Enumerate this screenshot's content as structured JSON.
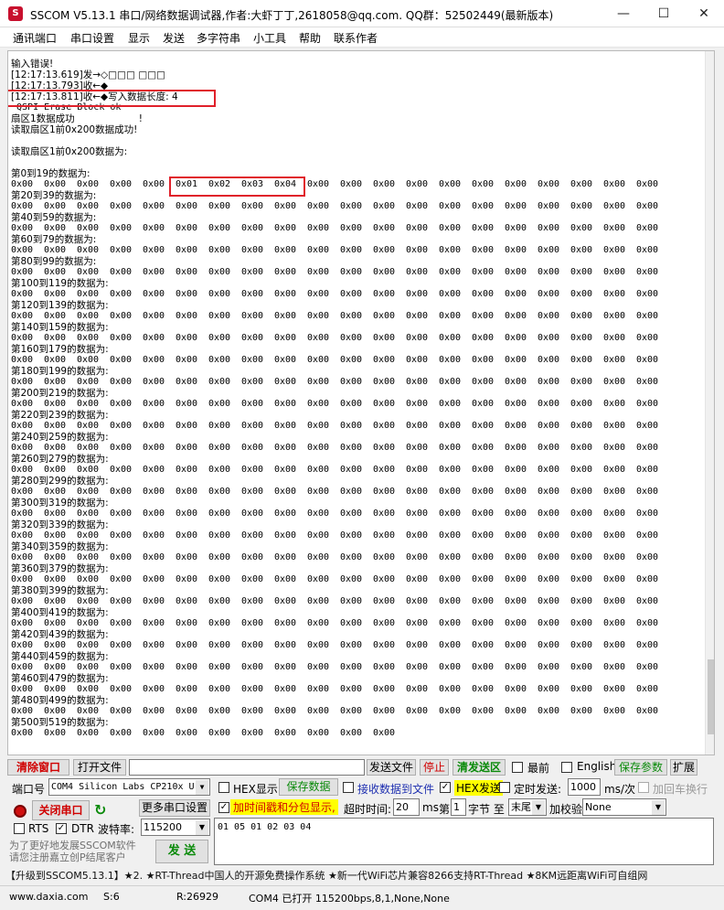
{
  "window": {
    "title": "SSCOM V5.13.1 串口/网络数据调试器,作者:大虾丁丁,2618058@qq.com. QQ群：52502449(最新版本)",
    "app_icon_glyph": "S",
    "minimize_glyph": "—",
    "maximize_glyph": "☐",
    "close_glyph": "✕"
  },
  "menu": {
    "items": [
      "通讯端口",
      "串口设置",
      "显示",
      "发送",
      "多字符串",
      "小工具",
      "帮助",
      "联系作者"
    ]
  },
  "terminal": {
    "lines": [
      "输入错误!",
      "[12:17:13.619]发→◇□□□ □□□",
      "[12:17:13.793]收←◆",
      "[12:17:13.811]收←◆写入数据长度: 4",
      " QSPI Erase Block ok",
      "扇区1数据成功                     !",
      "读取扇区1前0x200数据成功!",
      "",
      "读取扇区1前0x200数据为:",
      ""
    ],
    "block_headers": [
      "第0到19的数据为:",
      "第20到39的数据为:",
      "第40到59的数据为:",
      "第60到79的数据为:",
      "第80到99的数据为:",
      "第100到119的数据为:",
      "第120到139的数据为:",
      "第140到159的数据为:",
      "第160到179的数据为:",
      "第180到199的数据为:",
      "第200到219的数据为:",
      "第220到239的数据为:",
      "第240到259的数据为:",
      "第260到279的数据为:",
      "第280到299的数据为:",
      "第300到319的数据为:",
      "第320到339的数据为:",
      "第340到359的数据为:",
      "第360到379的数据为:",
      "第380到399的数据为:",
      "第400到419的数据为:",
      "第420到439的数据为:",
      "第440到459的数据为:",
      "第460到479的数据为:",
      "第480到499的数据为:",
      "第500到519的数据为:"
    ],
    "hex_rows": [
      [
        "0x00",
        "0x00",
        "0x00",
        "0x00",
        "0x00",
        "0x01",
        "0x02",
        "0x03",
        "0x04",
        "0x00",
        "0x00",
        "0x00",
        "0x00",
        "0x00",
        "0x00",
        "0x00",
        "0x00",
        "0x00",
        "0x00",
        "0x00"
      ],
      [
        "0x00",
        "0x00",
        "0x00",
        "0x00",
        "0x00",
        "0x00",
        "0x00",
        "0x00",
        "0x00",
        "0x00",
        "0x00",
        "0x00",
        "0x00",
        "0x00",
        "0x00",
        "0x00",
        "0x00",
        "0x00",
        "0x00",
        "0x00"
      ],
      [
        "0x00",
        "0x00",
        "0x00",
        "0x00",
        "0x00",
        "0x00",
        "0x00",
        "0x00",
        "0x00",
        "0x00",
        "0x00",
        "0x00",
        "0x00",
        "0x00",
        "0x00",
        "0x00",
        "0x00",
        "0x00",
        "0x00",
        "0x00"
      ],
      [
        "0x00",
        "0x00",
        "0x00",
        "0x00",
        "0x00",
        "0x00",
        "0x00",
        "0x00",
        "0x00",
        "0x00",
        "0x00",
        "0x00",
        "0x00",
        "0x00",
        "0x00",
        "0x00",
        "0x00",
        "0x00",
        "0x00",
        "0x00"
      ],
      [
        "0x00",
        "0x00",
        "0x00",
        "0x00",
        "0x00",
        "0x00",
        "0x00",
        "0x00",
        "0x00",
        "0x00",
        "0x00",
        "0x00",
        "0x00",
        "0x00",
        "0x00",
        "0x00",
        "0x00",
        "0x00",
        "0x00",
        "0x00"
      ],
      [
        "0x00",
        "0x00",
        "0x00",
        "0x00",
        "0x00",
        "0x00",
        "0x00",
        "0x00",
        "0x00",
        "0x00",
        "0x00",
        "0x00",
        "0x00",
        "0x00",
        "0x00",
        "0x00",
        "0x00",
        "0x00",
        "0x00",
        "0x00"
      ],
      [
        "0x00",
        "0x00",
        "0x00",
        "0x00",
        "0x00",
        "0x00",
        "0x00",
        "0x00",
        "0x00",
        "0x00",
        "0x00",
        "0x00",
        "0x00",
        "0x00",
        "0x00",
        "0x00",
        "0x00",
        "0x00",
        "0x00",
        "0x00"
      ],
      [
        "0x00",
        "0x00",
        "0x00",
        "0x00",
        "0x00",
        "0x00",
        "0x00",
        "0x00",
        "0x00",
        "0x00",
        "0x00",
        "0x00",
        "0x00",
        "0x00",
        "0x00",
        "0x00",
        "0x00",
        "0x00",
        "0x00",
        "0x00"
      ],
      [
        "0x00",
        "0x00",
        "0x00",
        "0x00",
        "0x00",
        "0x00",
        "0x00",
        "0x00",
        "0x00",
        "0x00",
        "0x00",
        "0x00",
        "0x00",
        "0x00",
        "0x00",
        "0x00",
        "0x00",
        "0x00",
        "0x00",
        "0x00"
      ],
      [
        "0x00",
        "0x00",
        "0x00",
        "0x00",
        "0x00",
        "0x00",
        "0x00",
        "0x00",
        "0x00",
        "0x00",
        "0x00",
        "0x00",
        "0x00",
        "0x00",
        "0x00",
        "0x00",
        "0x00",
        "0x00",
        "0x00",
        "0x00"
      ],
      [
        "0x00",
        "0x00",
        "0x00",
        "0x00",
        "0x00",
        "0x00",
        "0x00",
        "0x00",
        "0x00",
        "0x00",
        "0x00",
        "0x00",
        "0x00",
        "0x00",
        "0x00",
        "0x00",
        "0x00",
        "0x00",
        "0x00",
        "0x00"
      ],
      [
        "0x00",
        "0x00",
        "0x00",
        "0x00",
        "0x00",
        "0x00",
        "0x00",
        "0x00",
        "0x00",
        "0x00",
        "0x00",
        "0x00",
        "0x00",
        "0x00",
        "0x00",
        "0x00",
        "0x00",
        "0x00",
        "0x00",
        "0x00"
      ],
      [
        "0x00",
        "0x00",
        "0x00",
        "0x00",
        "0x00",
        "0x00",
        "0x00",
        "0x00",
        "0x00",
        "0x00",
        "0x00",
        "0x00",
        "0x00",
        "0x00",
        "0x00",
        "0x00",
        "0x00",
        "0x00",
        "0x00",
        "0x00"
      ],
      [
        "0x00",
        "0x00",
        "0x00",
        "0x00",
        "0x00",
        "0x00",
        "0x00",
        "0x00",
        "0x00",
        "0x00",
        "0x00",
        "0x00",
        "0x00",
        "0x00",
        "0x00",
        "0x00",
        "0x00",
        "0x00",
        "0x00",
        "0x00"
      ],
      [
        "0x00",
        "0x00",
        "0x00",
        "0x00",
        "0x00",
        "0x00",
        "0x00",
        "0x00",
        "0x00",
        "0x00",
        "0x00",
        "0x00",
        "0x00",
        "0x00",
        "0x00",
        "0x00",
        "0x00",
        "0x00",
        "0x00",
        "0x00"
      ],
      [
        "0x00",
        "0x00",
        "0x00",
        "0x00",
        "0x00",
        "0x00",
        "0x00",
        "0x00",
        "0x00",
        "0x00",
        "0x00",
        "0x00",
        "0x00",
        "0x00",
        "0x00",
        "0x00",
        "0x00",
        "0x00",
        "0x00",
        "0x00"
      ],
      [
        "0x00",
        "0x00",
        "0x00",
        "0x00",
        "0x00",
        "0x00",
        "0x00",
        "0x00",
        "0x00",
        "0x00",
        "0x00",
        "0x00",
        "0x00",
        "0x00",
        "0x00",
        "0x00",
        "0x00",
        "0x00",
        "0x00",
        "0x00"
      ],
      [
        "0x00",
        "0x00",
        "0x00",
        "0x00",
        "0x00",
        "0x00",
        "0x00",
        "0x00",
        "0x00",
        "0x00",
        "0x00",
        "0x00",
        "0x00",
        "0x00",
        "0x00",
        "0x00",
        "0x00",
        "0x00",
        "0x00",
        "0x00"
      ],
      [
        "0x00",
        "0x00",
        "0x00",
        "0x00",
        "0x00",
        "0x00",
        "0x00",
        "0x00",
        "0x00",
        "0x00",
        "0x00",
        "0x00",
        "0x00",
        "0x00",
        "0x00",
        "0x00",
        "0x00",
        "0x00",
        "0x00",
        "0x00"
      ],
      [
        "0x00",
        "0x00",
        "0x00",
        "0x00",
        "0x00",
        "0x00",
        "0x00",
        "0x00",
        "0x00",
        "0x00",
        "0x00",
        "0x00",
        "0x00",
        "0x00",
        "0x00",
        "0x00",
        "0x00",
        "0x00",
        "0x00",
        "0x00"
      ],
      [
        "0x00",
        "0x00",
        "0x00",
        "0x00",
        "0x00",
        "0x00",
        "0x00",
        "0x00",
        "0x00",
        "0x00",
        "0x00",
        "0x00",
        "0x00",
        "0x00",
        "0x00",
        "0x00",
        "0x00",
        "0x00",
        "0x00",
        "0x00"
      ],
      [
        "0x00",
        "0x00",
        "0x00",
        "0x00",
        "0x00",
        "0x00",
        "0x00",
        "0x00",
        "0x00",
        "0x00",
        "0x00",
        "0x00",
        "0x00",
        "0x00",
        "0x00",
        "0x00",
        "0x00",
        "0x00",
        "0x00",
        "0x00"
      ],
      [
        "0x00",
        "0x00",
        "0x00",
        "0x00",
        "0x00",
        "0x00",
        "0x00",
        "0x00",
        "0x00",
        "0x00",
        "0x00",
        "0x00",
        "0x00",
        "0x00",
        "0x00",
        "0x00",
        "0x00",
        "0x00",
        "0x00",
        "0x00"
      ],
      [
        "0x00",
        "0x00",
        "0x00",
        "0x00",
        "0x00",
        "0x00",
        "0x00",
        "0x00",
        "0x00",
        "0x00",
        "0x00",
        "0x00",
        "0x00",
        "0x00",
        "0x00",
        "0x00",
        "0x00",
        "0x00",
        "0x00",
        "0x00"
      ],
      [
        "0x00",
        "0x00",
        "0x00",
        "0x00",
        "0x00",
        "0x00",
        "0x00",
        "0x00",
        "0x00",
        "0x00",
        "0x00",
        "0x00",
        "0x00",
        "0x00",
        "0x00",
        "0x00",
        "0x00",
        "0x00",
        "0x00",
        "0x00"
      ],
      [
        "0x00",
        "0x00",
        "0x00",
        "0x00",
        "0x00",
        "0x00",
        "0x00",
        "0x00",
        "0x00",
        "0x00",
        "0x00",
        "0x00"
      ]
    ]
  },
  "toolbar": {
    "clear_window": "清除窗口",
    "open_file": "打开文件",
    "send_file": "发送文件",
    "stop": "停止",
    "clear_send": "清发送区",
    "topmost": "最前",
    "english": "English",
    "save_params": "保存参数",
    "expand": "扩展"
  },
  "settings": {
    "port_label": "端口号",
    "port_value": "COM4 Silicon Labs CP210x U",
    "hex_display": "HEX显示",
    "save_data": "保存数据",
    "recv_to_file": "接收数据到文件",
    "hex_send": "HEX发送",
    "timed_send": "定时发送:",
    "timed_ms": "1000",
    "ms_unit": "ms/次",
    "add_crlf": "加回车换行",
    "close_port": "关闭串口",
    "more_settings": "更多串口设置",
    "timestamp": "加时间戳和分包显示,",
    "timeout_label": "超时时间:",
    "timeout_value": "20",
    "ms": "ms",
    "nth_label": "第",
    "nth_value": "1",
    "byte_label": "字节 至",
    "end_value": "末尾",
    "checksum_label": "加校验",
    "checksum_value": "None",
    "rts": "RTS",
    "dtr": "DTR",
    "baud_label": "波特率:",
    "baud_value": "115200",
    "send_text": "01 05 01 02 03 04",
    "send": "发 送",
    "promo": "为了更好地发展SSCOM软件\n请您注册嘉立创P结尾客户"
  },
  "ticker": "【升级到SSCOM5.13.1】★2. ★RT-Thread中国人的开源免费操作系统 ★新一代WiFi芯片兼容8266支持RT-Thread ★8KM远距离WiFi可自组网",
  "statusbar": {
    "website": "www.daxia.com",
    "s": "S:6",
    "r": "R:26929",
    "port": "COM4 已打开  115200bps,8,1,None,None"
  }
}
